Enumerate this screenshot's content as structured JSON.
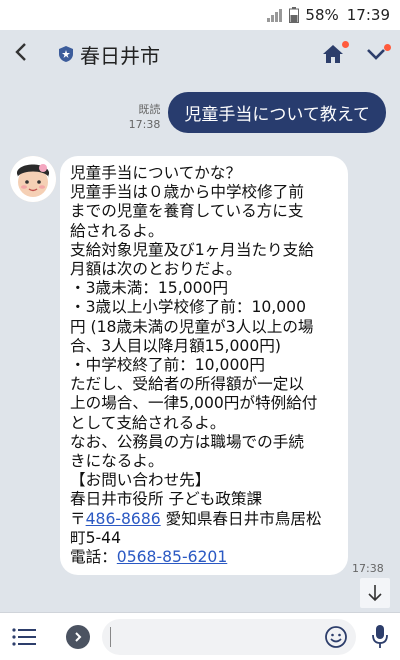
{
  "statusbar": {
    "battery": "58%",
    "time": "17:39"
  },
  "header": {
    "title": "春日井市"
  },
  "sent_message": {
    "read_label": "既読",
    "time": "17:38",
    "text": "児童手当について教えて"
  },
  "received_message": {
    "time": "17:38",
    "lines": [
      "児童手当についてかな？",
      "児童手当は０歳から中学校修了前",
      "までの児童を養育している方に支",
      "給されるよ。",
      "支給対象児童及び1ヶ月当たり支給",
      "月額は次のとおりだよ。",
      "・3歳未満：15,000円",
      "・3歳以上小学校修了前：10,000",
      "円 (18歳未満の児童が3人以上の場",
      "合、3人目以降月額15,000円)",
      "・中学校終了前：10,000円",
      "ただし、受給者の所得額が一定以",
      "上の場合、一律5,000円が特例給付",
      "として支給されるよ。",
      "なお、公務員の方は職場での手続",
      "きになるよ。",
      "【お問い合わせ先】",
      "春日井市役所 子ども政策課"
    ],
    "postal_prefix": "〒",
    "postal_code": "486-8686",
    "address": " 愛知県春日井市鳥居松",
    "address_line2": "町5-44",
    "phone_prefix": "電話：",
    "phone": "0568-85-6201"
  },
  "input": {
    "placeholder": ""
  },
  "colors": {
    "sent_bubble": "#283c6e",
    "link": "#2b59c3",
    "background": "#dfe4ea"
  }
}
